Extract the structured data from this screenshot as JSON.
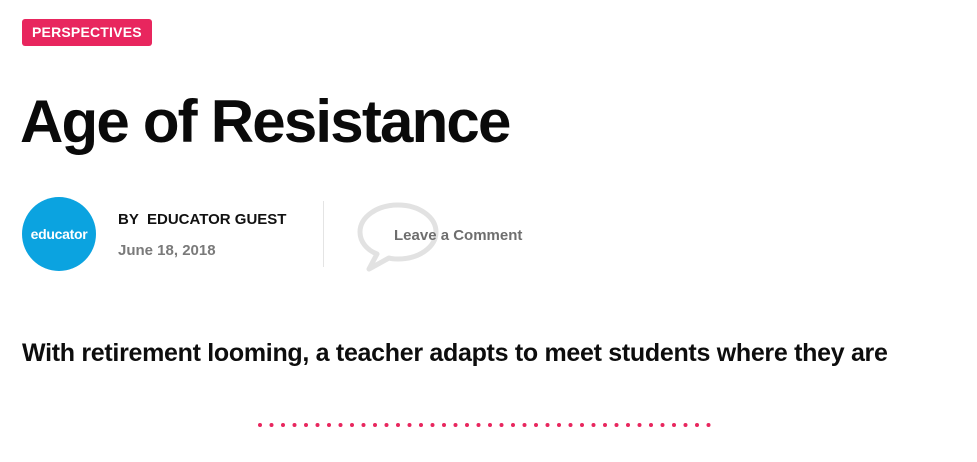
{
  "article": {
    "category": "PERSPECTIVES",
    "title": "Age of Resistance",
    "subtitle": "With retirement looming, a teacher adapts to meet students where they are"
  },
  "meta": {
    "avatar_text": "educator",
    "by_label": "BY",
    "author": "EDUCATOR GUEST",
    "date": "June 18, 2018",
    "comment_label": "Leave a Comment",
    "comment_icon": "speech-bubble-icon"
  },
  "colors": {
    "accent": "#e8265e",
    "avatar": "#0ba3e0",
    "muted_text": "#7a7a7a",
    "comment_icon": "#e2e2e2"
  }
}
